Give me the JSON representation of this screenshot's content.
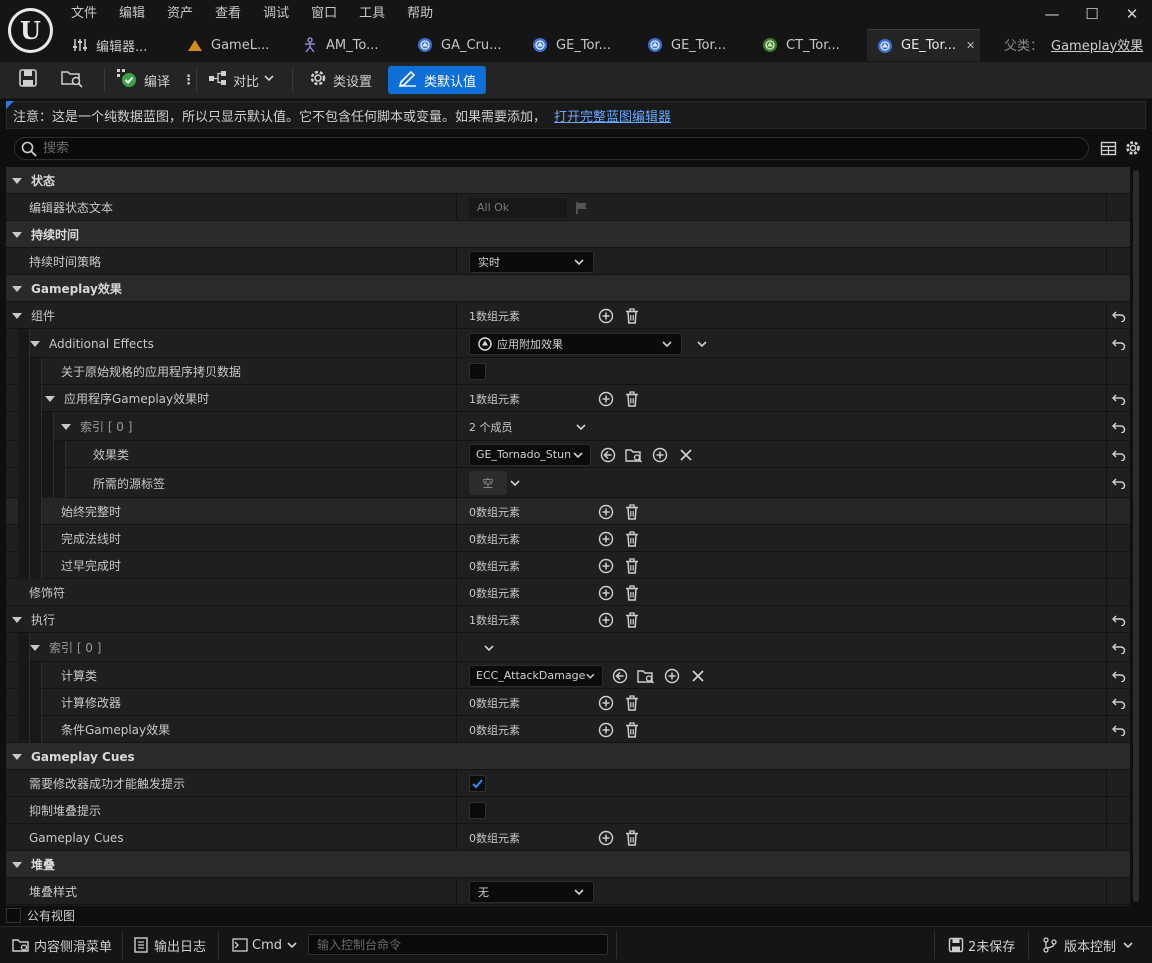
{
  "menu": [
    "文件",
    "编辑",
    "资产",
    "查看",
    "调试",
    "窗口",
    "工具",
    "帮助"
  ],
  "tabs": [
    {
      "label": "编辑器...",
      "icon": "sliders-icon"
    },
    {
      "label": "GameL...",
      "icon": "mountain-icon"
    },
    {
      "label": "AM_To...",
      "icon": "skeleton-icon"
    },
    {
      "label": "GA_Cru...",
      "icon": "blueprint-icon"
    },
    {
      "label": "GE_Tor...",
      "icon": "blueprint-icon"
    },
    {
      "label": "GE_Tor...",
      "icon": "blueprint-icon"
    },
    {
      "label": "CT_Tor...",
      "icon": "curvetable-icon"
    },
    {
      "label": "GE_Tor...",
      "icon": "blueprint-icon",
      "active": true
    }
  ],
  "parent": {
    "label": "父类：",
    "value": "Gameplay效果"
  },
  "toolbar": {
    "compile_label": "编译",
    "diff_label": "对比",
    "class_settings_label": "类设置",
    "class_defaults_label": "类默认值"
  },
  "notice": {
    "text": "注意：这是一个纯数据蓝图，所以只显示默认值。它不包含任何脚本或变量。如果需要添加，",
    "link": "打开完整蓝图编辑器"
  },
  "search": {
    "placeholder": "搜索"
  },
  "details": {
    "cat_state": "状态",
    "editor_state_text": "编辑器状态文本",
    "editor_state_value": "All Ok",
    "cat_duration": "持续时间",
    "duration_policy": "持续时间策略",
    "duration_policy_value": "实时",
    "cat_gameplay_effect": "Gameplay效果",
    "components": "组件",
    "components_count": "1数组元素",
    "additional_effects": "Additional Effects",
    "additional_effects_value": "应用附加效果",
    "copy_data": "关于原始规格的应用程序拷贝数据",
    "on_application": "应用程序Gameplay效果时",
    "on_application_count": "1数组元素",
    "index0": "索引 [ 0 ]",
    "index0_members": "2 个成员",
    "effect_class": "效果类",
    "effect_class_value": "GE_Tornado_Stun",
    "source_tags": "所需的源标签",
    "source_tags_value": "空",
    "on_complete_always": "始终完整时",
    "on_complete_always_count": "0数组元素",
    "on_complete_normal": "完成法线时",
    "on_complete_normal_count": "0数组元素",
    "on_complete_prematurely": "过早完成时",
    "on_complete_prematurely_count": "0数组元素",
    "modifiers": "修饰符",
    "modifiers_count": "0数组元素",
    "executions": "执行",
    "executions_count": "1数组元素",
    "exec_index0": "索引 [ 0 ]",
    "calc_class": "计算类",
    "calc_class_value": "ECC_AttackDamage",
    "calc_modifiers": "计算修改器",
    "calc_modifiers_count": "0数组元素",
    "conditional_effects": "条件Gameplay效果",
    "conditional_effects_count": "0数组元素",
    "cat_cues": "Gameplay Cues",
    "require_modifier_success": "需要修改器成功才能触发提示",
    "suppress_stacking_cues": "抑制堆叠提示",
    "gameplay_cues": "Gameplay Cues",
    "gameplay_cues_count": "0数组元素",
    "cat_stacking": "堆叠",
    "stacking_type": "堆叠样式",
    "stacking_type_value": "无"
  },
  "public_view": "公有视图",
  "statusbar": {
    "content_drawer": "内容侧滑菜单",
    "output_log": "输出日志",
    "cmd": "Cmd",
    "console_placeholder": "输入控制台命令",
    "unsaved": "2未保存",
    "source_control": "版本控制"
  },
  "colors": {
    "accent": "#0e6fd8",
    "link": "#6aa7ff",
    "check": "#2d8cff"
  }
}
